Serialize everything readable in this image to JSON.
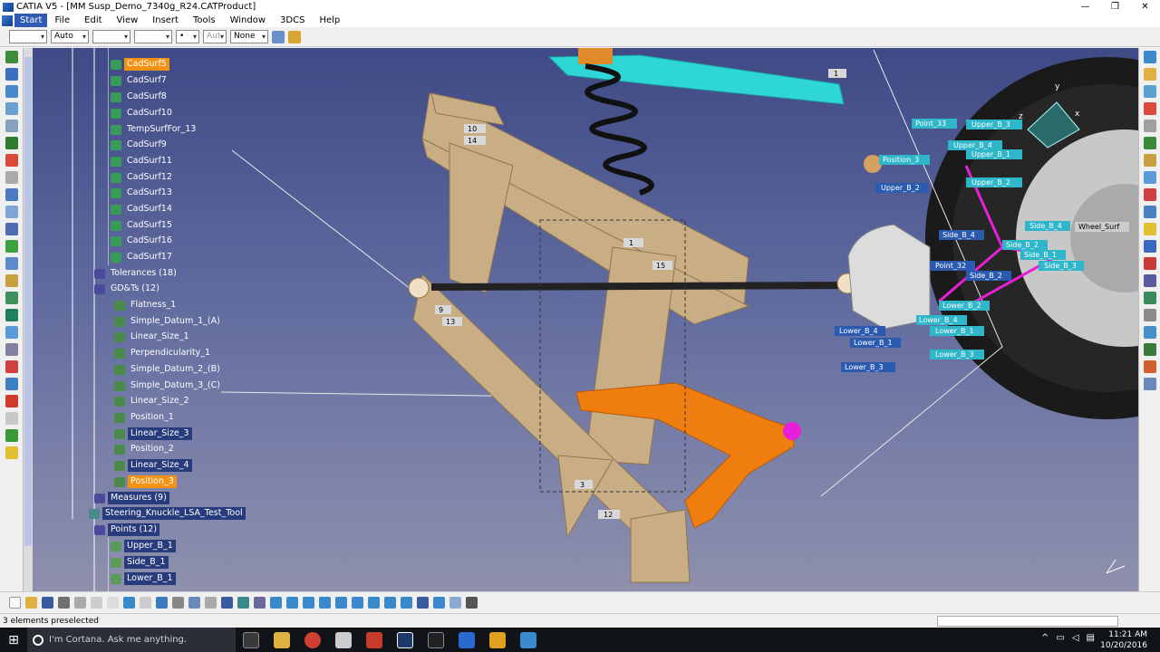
{
  "window": {
    "title": "CATIA V5 - [MM Susp_Demo_7340g_R24.CATProduct]",
    "minimize": "—",
    "maximize": "❐",
    "close": "✕"
  },
  "menu": [
    "Start",
    "File",
    "Edit",
    "View",
    "Insert",
    "Tools",
    "Window",
    "3DCS",
    "Help"
  ],
  "toolbar": {
    "combo_auto": "Auto",
    "combo_aut": "Aut",
    "combo_none": "None",
    "combo_dot": "•"
  },
  "tree": {
    "items": [
      {
        "label": "CadSurf5",
        "hl": "orange"
      },
      {
        "label": "CadSurf7"
      },
      {
        "label": "CadSurf8"
      },
      {
        "label": "CadSurf10"
      },
      {
        "label": "TempSurfFor_13"
      },
      {
        "label": "CadSurf9"
      },
      {
        "label": "CadSurf11"
      },
      {
        "label": "CadSurf12"
      },
      {
        "label": "CadSurf13"
      },
      {
        "label": "CadSurf14"
      },
      {
        "label": "CadSurf15"
      },
      {
        "label": "CadSurf16"
      },
      {
        "label": "CadSurf17"
      },
      {
        "label": "Tolerances (18)"
      },
      {
        "label": "GD&Ts (12)"
      },
      {
        "label": "Flatness_1"
      },
      {
        "label": "Simple_Datum_1_(A)"
      },
      {
        "label": "Linear_Size_1"
      },
      {
        "label": "Perpendicularity_1"
      },
      {
        "label": "Simple_Datum_2_(B)"
      },
      {
        "label": "Simple_Datum_3_(C)"
      },
      {
        "label": "Linear_Size_2"
      },
      {
        "label": "Position_1"
      },
      {
        "label": "Linear_Size_3",
        "hl": "blue"
      },
      {
        "label": "Position_2"
      },
      {
        "label": "Linear_Size_4",
        "hl": "blue"
      },
      {
        "label": "Position_3",
        "hl": "orange"
      },
      {
        "label": "Measures (9)",
        "hl": "blue"
      },
      {
        "label": "Steering_Knuckle_LSA_Test_Tool",
        "hl": "blue"
      },
      {
        "label": "Points (12)",
        "hl": "blue"
      },
      {
        "label": "Upper_B_1",
        "hl": "blue"
      },
      {
        "label": "Side_B_1",
        "hl": "blue"
      },
      {
        "label": "Lower_B_1",
        "hl": "blue"
      }
    ]
  },
  "viewport_labels": {
    "tags": [
      "10",
      "14",
      "1",
      "15",
      "9",
      "13",
      "3",
      "12",
      "1"
    ],
    "points": [
      "Point_33",
      "Upper_B_3",
      "Upper_B_4",
      "Upper_B_1",
      "Upper_B_2",
      "Position_3",
      "Upper_B_2",
      "Side_B_4",
      "Side_B_2",
      "Side_B_1",
      "Side_B_3",
      "Side_B_4",
      "Point_32",
      "Side_B_2",
      "Lower_B_2",
      "Lower_B_4",
      "Lower_B_1",
      "Lower_B_3",
      "Lower_B_4",
      "Lower_B_1",
      "Lower_B_3",
      "Wheel_Surf"
    ]
  },
  "status": {
    "text": "3 elements preselected"
  },
  "taskbar": {
    "search": "I'm Cortana. Ask me anything.",
    "time": "11:21 AM",
    "date": "10/20/2016"
  },
  "colors": {
    "viewport_top": "#3f4a86",
    "tan": "#c9ad84",
    "cyan": "#2fd6d6",
    "orange": "#f07d10",
    "magenta": "#e81ed8",
    "label_bg": "#2fb6c9"
  }
}
